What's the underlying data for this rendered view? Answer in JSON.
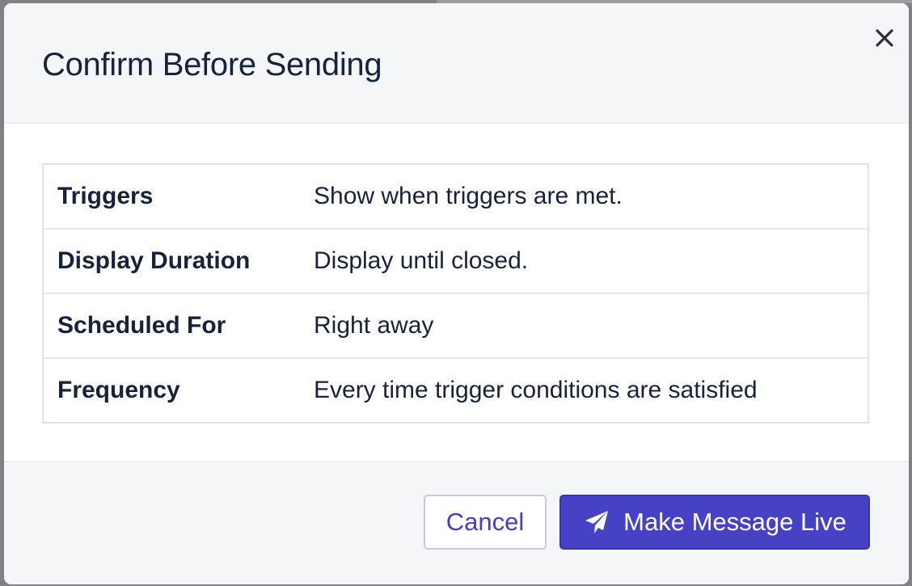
{
  "modal": {
    "title": "Confirm Before Sending",
    "close_icon": "close-icon"
  },
  "summary": {
    "rows": [
      {
        "label": "Triggers",
        "value": "Show when triggers are met."
      },
      {
        "label": "Display Duration",
        "value": "Display until closed."
      },
      {
        "label": "Scheduled For",
        "value": "Right away"
      },
      {
        "label": "Frequency",
        "value": "Every time trigger conditions are satisfied"
      }
    ]
  },
  "footer": {
    "cancel_label": "Cancel",
    "confirm_label": "Make Message Live",
    "confirm_icon": "paper-plane-icon"
  },
  "colors": {
    "primary": "#4741c6",
    "header_bg": "#f4f6f8",
    "text": "#17223b"
  }
}
